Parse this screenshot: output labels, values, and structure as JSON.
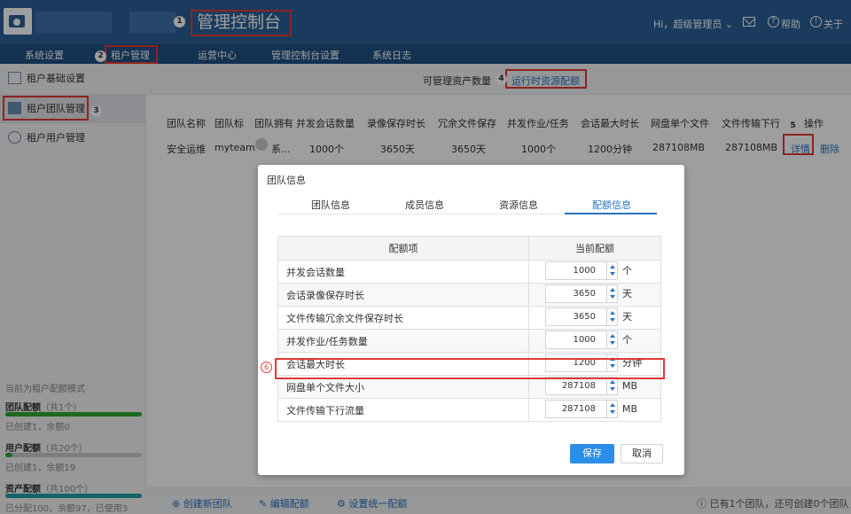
{
  "header": {
    "title": "管理控制台",
    "user": "Hi，超级管理员",
    "help": "帮助",
    "about": "关于"
  },
  "steps": [
    "1",
    "2",
    "3",
    "4",
    "5",
    "6"
  ],
  "nav": [
    "系统设置",
    "租户管理",
    "运营中心",
    "管理控制台设置",
    "系统日志"
  ],
  "sidebar": {
    "items": [
      "租户基础设置",
      "租户团队管理",
      "租户用户管理"
    ],
    "quota_mode": "当前为租户配额模式",
    "quotas": [
      {
        "label": "团队配额",
        "total": "（共1个）",
        "sub": "已创建1，余额0",
        "fill": 1.0,
        "color": "#2fa82f"
      },
      {
        "label": "用户配额",
        "total": "（共20个）",
        "sub": "已创建1，余额19",
        "fill": 0.05,
        "color": "#2fa82f"
      },
      {
        "label": "资产配额",
        "total": "（共100个）",
        "sub": "已分配100，余额97，已使用3",
        "fill": 1.0,
        "color": "#1fa3a8"
      }
    ]
  },
  "subtabs": [
    "可管理资产数量",
    "运行时资源配额"
  ],
  "table": {
    "headers": [
      "团队名称",
      "团队标",
      "团队拥有",
      "并发会话数量",
      "录像保存时长",
      "冗余文件保存",
      "并发作业/任务",
      "会话最大时长",
      "网盘单个文件",
      "文件传输下行",
      "操作"
    ],
    "row": [
      "安全运维",
      "myteam",
      "系...",
      "1000个",
      "3650天",
      "3650天",
      "1000个",
      "1200分钟",
      "287108MB",
      "287108MB"
    ],
    "actions": [
      "详情",
      "删除"
    ]
  },
  "bottombar": {
    "create": "创建新团队",
    "edit": "编辑配额",
    "unify": "设置统一配额",
    "status": "已有1个团队，还可创建0个团队"
  },
  "modal": {
    "title": "团队信息",
    "tabs": [
      "团队信息",
      "成员信息",
      "资源信息",
      "配额信息"
    ],
    "col_item": "配额项",
    "col_value": "当前配额",
    "rows": [
      {
        "item": "并发会话数量",
        "value": "1000",
        "unit": "个"
      },
      {
        "item": "会话录像保存时长",
        "value": "3650",
        "unit": "天"
      },
      {
        "item": "文件传输冗余文件保存时长",
        "value": "3650",
        "unit": "天"
      },
      {
        "item": "并发作业/任务数量",
        "value": "1000",
        "unit": "个"
      },
      {
        "item": "会话最大时长",
        "value": "1200",
        "unit": "分钟"
      },
      {
        "item": "网盘单个文件大小",
        "value": "287108",
        "unit": "MB"
      },
      {
        "item": "文件传输下行流量",
        "value": "287108",
        "unit": "MB"
      }
    ],
    "save": "保存",
    "cancel": "取消"
  }
}
